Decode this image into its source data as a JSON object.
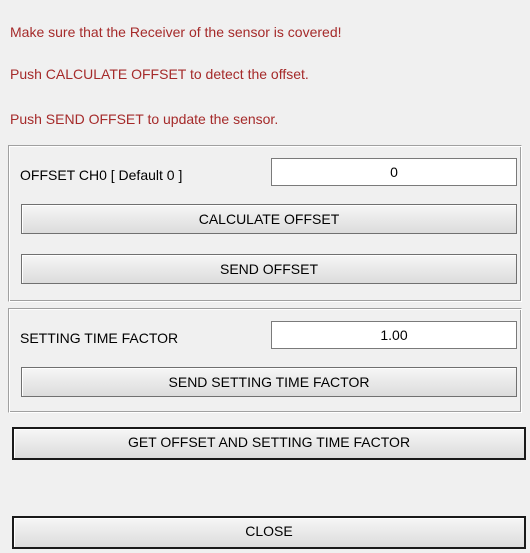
{
  "instructions": [
    "Make sure that the Receiver of the sensor is covered!",
    "Push CALCULATE OFFSET to detect the offset.",
    "Push SEND OFFSET to update the sensor."
  ],
  "offset_panel": {
    "offset_label": "OFFSET CH0 [ Default 0 ]",
    "offset_value": "0",
    "calculate_button": "CALCULATE OFFSET",
    "send_button": "SEND OFFSET"
  },
  "setting_panel": {
    "setting_label": "SETTING TIME FACTOR",
    "setting_value": "1.00",
    "send_button": "SEND SETTING TIME FACTOR"
  },
  "get_button": "GET OFFSET AND SETTING TIME FACTOR",
  "close_button": "CLOSE",
  "colors": {
    "instruction_text": "#a52a2a",
    "background": "#f0f0f0"
  }
}
